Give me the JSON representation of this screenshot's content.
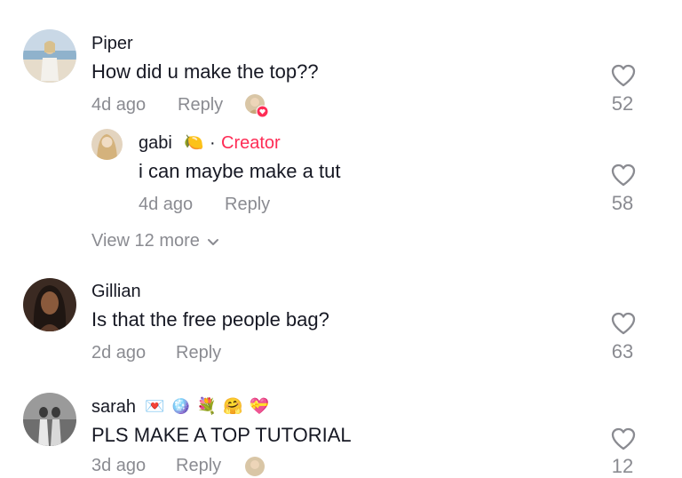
{
  "comments": [
    {
      "username": "Piper",
      "text": "How did u make the top??",
      "time": "4d ago",
      "reply_label": "Reply",
      "likes": "52",
      "replies": [
        {
          "username": "gabi",
          "username_emoji": "🍋",
          "creator_sep": "·",
          "creator_label": "Creator",
          "text": "i can maybe make a tut",
          "time": "4d ago",
          "reply_label": "Reply",
          "likes": "58"
        }
      ],
      "view_more_label": "View 12 more"
    },
    {
      "username": "Gillian",
      "text": "Is that the free people bag?",
      "time": "2d ago",
      "reply_label": "Reply",
      "likes": "63"
    },
    {
      "username": "sarah",
      "username_emojis": [
        "💌",
        "🪩",
        "💐",
        "🤗",
        "💝"
      ],
      "text": "PLS MAKE A TOP TUTORIAL",
      "time": "3d ago",
      "reply_label": "Reply",
      "likes": "12"
    }
  ],
  "colors": {
    "text": "#161823",
    "secondary": "#8a8b91",
    "creator": "#fe2c55",
    "liked_badge": "#fe2c55"
  }
}
